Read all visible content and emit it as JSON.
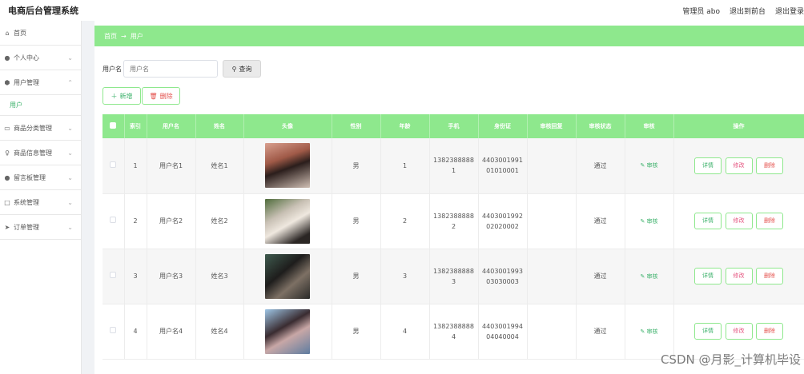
{
  "app": {
    "title": "电商后台管理系统"
  },
  "topbar": {
    "user": "管理员 abo",
    "to_front": "退出到前台",
    "logout": "退出登录"
  },
  "sidebar": {
    "items": [
      {
        "label": "首页",
        "icon": "home-icon"
      },
      {
        "label": "个人中心",
        "icon": "person-icon"
      },
      {
        "label": "用户管理",
        "icon": "user-shield-icon"
      },
      {
        "label": "用户",
        "sub": true
      },
      {
        "label": "商品分类管理",
        "icon": "category-icon"
      },
      {
        "label": "商品信息管理",
        "icon": "product-icon"
      },
      {
        "label": "留言板管理",
        "icon": "message-icon"
      },
      {
        "label": "系统管理",
        "icon": "system-icon"
      },
      {
        "label": "订单管理",
        "icon": "order-icon"
      }
    ]
  },
  "breadcrumb": {
    "home": "首页",
    "arrow": "→",
    "current": "用户"
  },
  "search": {
    "label": "用户名",
    "placeholder": "用户名",
    "button": "查询"
  },
  "actions": {
    "add": "新增",
    "delete": "删除"
  },
  "table": {
    "headers": [
      "索引",
      "用户名",
      "姓名",
      "头像",
      "性别",
      "年龄",
      "手机",
      "身份证",
      "审核回复",
      "审核状态",
      "审核",
      "操作"
    ],
    "rows": [
      {
        "index": "1",
        "username": "用户名1",
        "name": "姓名1",
        "gender": "男",
        "age": "1",
        "phone": "13823888881",
        "idcard": "440300199101010001",
        "reply": "",
        "status": "通过",
        "audit": "审核"
      },
      {
        "index": "2",
        "username": "用户名2",
        "name": "姓名2",
        "gender": "男",
        "age": "2",
        "phone": "13823888882",
        "idcard": "440300199202020002",
        "reply": "",
        "status": "通过",
        "audit": "审核"
      },
      {
        "index": "3",
        "username": "用户名3",
        "name": "姓名3",
        "gender": "男",
        "age": "3",
        "phone": "13823888883",
        "idcard": "440300199303030003",
        "reply": "",
        "status": "通过",
        "audit": "审核"
      },
      {
        "index": "4",
        "username": "用户名4",
        "name": "姓名4",
        "gender": "男",
        "age": "4",
        "phone": "13823888884",
        "idcard": "440300199404040004",
        "reply": "",
        "status": "通过",
        "audit": "审核"
      }
    ],
    "op_buttons": {
      "detail": "详情",
      "edit": "修改",
      "remove": "删除"
    }
  },
  "watermark": "CSDN @月影_计算机毕设",
  "colors": {
    "accent": "#8ee88d",
    "link": "#3bb16a",
    "danger": "#e4534f"
  }
}
